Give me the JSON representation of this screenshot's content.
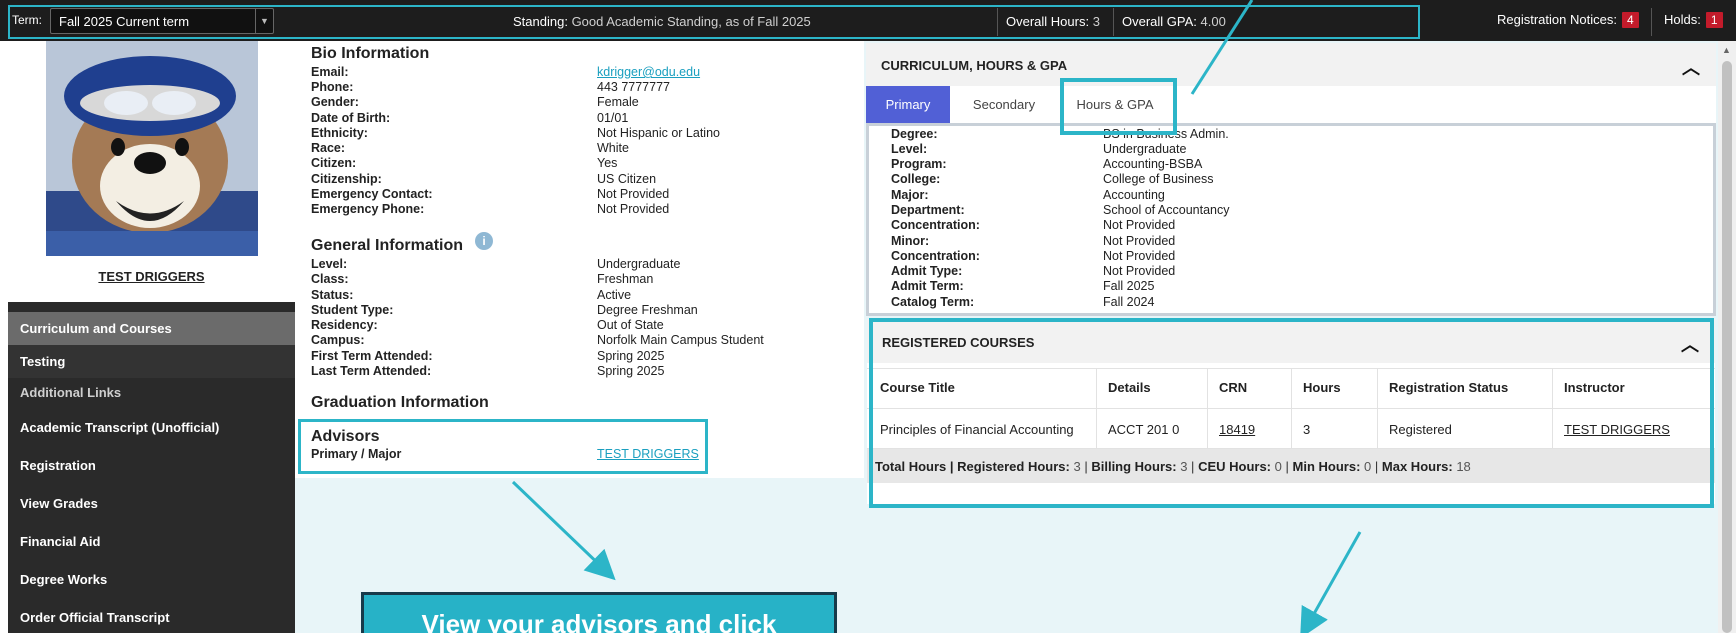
{
  "topbar": {
    "term_label": "Term:",
    "term_value": "Fall 2025 Current term",
    "standing_label": "Standing:",
    "standing_value": "Good Academic Standing, as of Fall 2025",
    "overall_hours_label": "Overall Hours:",
    "overall_hours_value": "3",
    "overall_gpa_label": "Overall GPA:",
    "overall_gpa_value": "4.00",
    "reg_notices_label": "Registration Notices:",
    "reg_notices_count": "4",
    "holds_label": "Holds:",
    "holds_count": "1"
  },
  "sidebar": {
    "student_name": "TEST DRIGGERS",
    "items": [
      {
        "label": "Curriculum and Courses"
      },
      {
        "label": "Testing"
      },
      {
        "label": "Additional Links"
      },
      {
        "label": "Academic Transcript (Unofficial)"
      },
      {
        "label": "Registration"
      },
      {
        "label": "View Grades"
      },
      {
        "label": "Financial Aid"
      },
      {
        "label": "Degree Works"
      },
      {
        "label": "Order Official Transcript"
      }
    ]
  },
  "bio": {
    "heading": "Bio Information",
    "email_label": "Email:",
    "email": "kdrigger@odu.edu",
    "phone_label": "Phone:",
    "phone": "443 7777777",
    "gender_label": "Gender:",
    "gender": "Female",
    "dob_label": "Date of Birth:",
    "dob": "01/01",
    "ethnicity_label": "Ethnicity:",
    "ethnicity": "Not Hispanic or Latino",
    "race_label": "Race:",
    "race": "White",
    "citizen_label": "Citizen:",
    "citizen": "Yes",
    "citizenship_label": "Citizenship:",
    "citizenship": "US Citizen",
    "em_contact_label": "Emergency Contact:",
    "em_contact": "Not Provided",
    "em_phone_label": "Emergency Phone:",
    "em_phone": "Not Provided"
  },
  "general": {
    "heading": "General Information",
    "level_label": "Level:",
    "level": "Undergraduate",
    "class_label": "Class:",
    "class": "Freshman",
    "status_label": "Status:",
    "status": "Active",
    "student_type_label": "Student Type:",
    "student_type": "Degree Freshman",
    "residency_label": "Residency:",
    "residency": "Out of State",
    "campus_label": "Campus:",
    "campus": "Norfolk Main Campus Student",
    "first_term_label": "First Term Attended:",
    "first_term": "Spring 2025",
    "last_term_label": "Last Term Attended:",
    "last_term": "Spring 2025"
  },
  "graduation": {
    "heading": "Graduation Information"
  },
  "advisors": {
    "heading": "Advisors",
    "role": "Primary / Major",
    "name": "TEST DRIGGERS"
  },
  "curriculum": {
    "title": "CURRICULUM, HOURS & GPA",
    "tabs": [
      {
        "label": "Primary"
      },
      {
        "label": "Secondary"
      },
      {
        "label": "Hours & GPA"
      }
    ],
    "degree_label": "Degree:",
    "degree": "BS in Business Admin.",
    "level_label": "Level:",
    "level": "Undergraduate",
    "program_label": "Program:",
    "program": "Accounting-BSBA",
    "college_label": "College:",
    "college": "College of Business",
    "major_label": "Major:",
    "major": "Accounting",
    "department_label": "Department:",
    "department": "School of Accountancy",
    "concentration_label": "Concentration:",
    "concentration": "Not Provided",
    "minor_label": "Minor:",
    "minor": "Not Provided",
    "concentration2_label": "Concentration:",
    "concentration2": "Not Provided",
    "admit_type_label": "Admit Type:",
    "admit_type": "Not Provided",
    "admit_term_label": "Admit Term:",
    "admit_term": "Fall 2025",
    "catalog_term_label": "Catalog Term:",
    "catalog_term": "Fall 2024"
  },
  "registered": {
    "title": "REGISTERED COURSES",
    "columns": [
      "Course Title",
      "Details",
      "CRN",
      "Hours",
      "Registration Status",
      "Instructor"
    ],
    "rows": [
      {
        "title": "Principles of Financial Accounting",
        "details": "ACCT 201 0",
        "crn": "18419",
        "hours": "3",
        "status": "Registered",
        "instructor": "TEST DRIGGERS"
      }
    ],
    "totals": {
      "total_label": "Total Hours |",
      "registered_label": "Registered Hours:",
      "registered": "3",
      "billing_label": "Billing Hours:",
      "billing": "3",
      "ceu_label": "CEU Hours:",
      "ceu": "0",
      "min_label": "Min Hours:",
      "min": "0",
      "max_label": "Max Hours:",
      "max": "18",
      "sep": "|"
    }
  },
  "callout": {
    "text": "View your advisors and click"
  },
  "colors": {
    "accent": "#2cb5c8",
    "tab_active": "#5160d6",
    "badge": "#c31b2b",
    "link": "#1a9fbf"
  }
}
